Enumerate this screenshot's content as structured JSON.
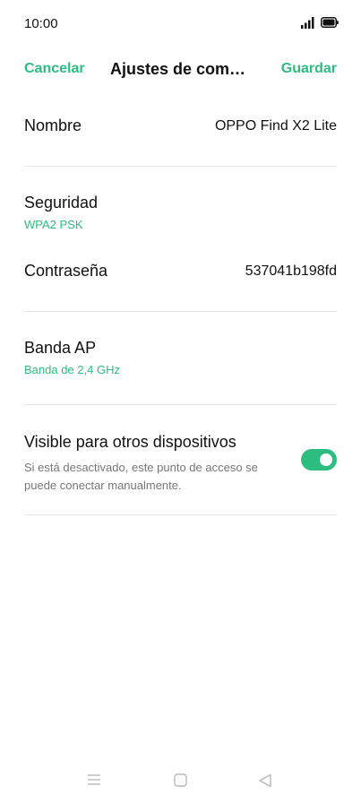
{
  "status_bar": {
    "time": "10:00"
  },
  "header": {
    "cancel_label": "Cancelar",
    "title": "Ajustes de comp…",
    "save_label": "Guardar"
  },
  "settings": {
    "name": {
      "label": "Nombre",
      "value": "OPPO Find X2 Lite"
    },
    "security": {
      "label": "Seguridad",
      "value": "WPA2 PSK"
    },
    "password": {
      "label": "Contraseña",
      "value": "537041b198fd"
    },
    "band": {
      "label": "Banda AP",
      "value": "Banda de 2,4 GHz"
    },
    "visible": {
      "label": "Visible para otros dispositivos",
      "description": "Si está desactivado, este punto de acceso se puede conectar manualmente.",
      "enabled": true
    }
  },
  "colors": {
    "accent": "#2dbd80",
    "text": "#111111",
    "secondary": "#777777"
  },
  "nav_bar": {
    "icons": [
      "menu-icon",
      "home-square-icon",
      "back-triangle-icon"
    ]
  }
}
